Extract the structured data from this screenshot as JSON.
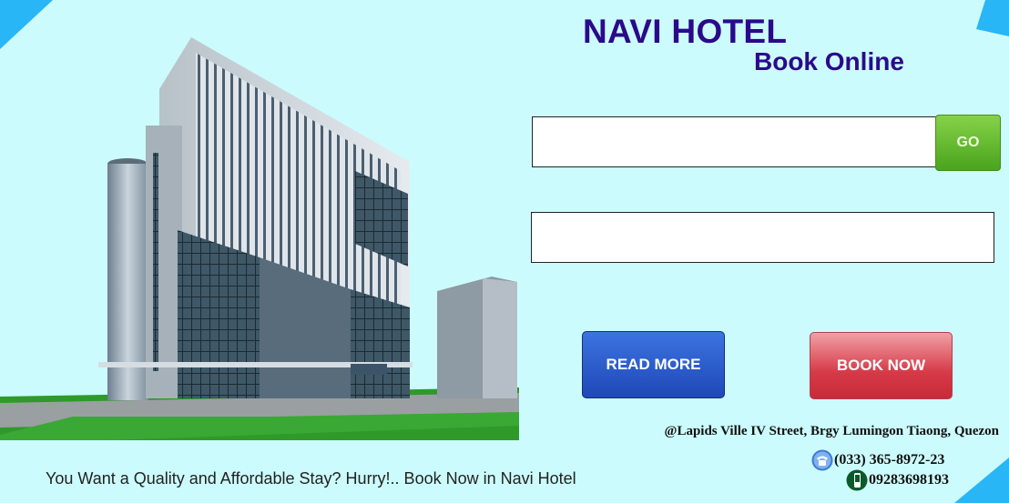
{
  "hotel": {
    "name": "NAVI HOTEL",
    "subtitle": "Book Online"
  },
  "booking": {
    "search_value": "",
    "second_value": "",
    "go_label": "GO"
  },
  "actions": {
    "read_more_label": "READ MORE",
    "book_now_label": "BOOK NOW"
  },
  "contact": {
    "address": "@Lapids Ville IV Street, Brgy Lumingon Tiaong, Quezon",
    "landline": "(033) 365-8972-23",
    "mobile": "09283698193",
    "landline_icon": "telephone-icon",
    "mobile_icon": "mobile-phone-icon"
  },
  "tagline": "You Want a Quality and Affordable Stay? Hurry!.. Book Now in Navi Hotel",
  "colors": {
    "background": "#ccfbfd",
    "title": "#2a0a8a",
    "go_button": "#4aa41c",
    "read_more_button": "#1f48b8",
    "book_now_button": "#d63a48",
    "corner_accent": "#29b6f6"
  }
}
